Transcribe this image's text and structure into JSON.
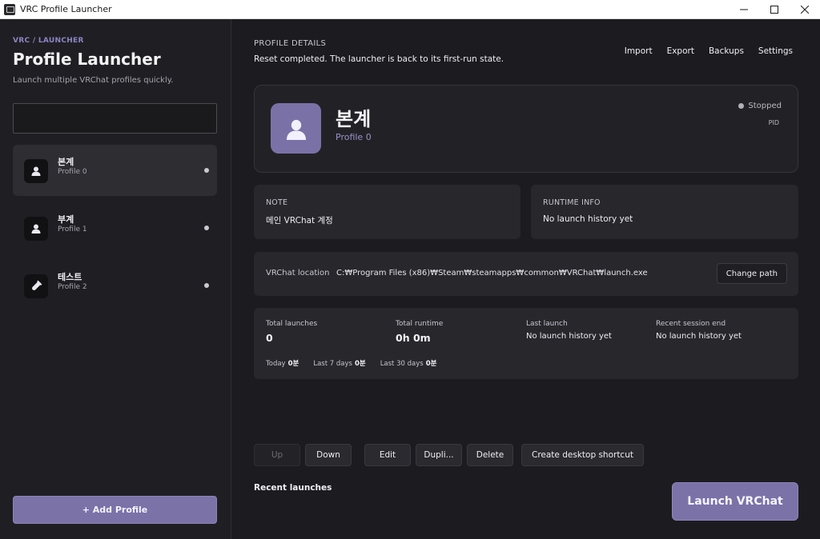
{
  "window": {
    "title": "VRC Profile Launcher",
    "minimize_glyph": "—",
    "maximize_glyph": "☐",
    "close_glyph": "✕"
  },
  "sidebar": {
    "breadcrumb": "VRC / LAUNCHER",
    "title": "Profile Launcher",
    "subtitle": "Launch multiple VRChat profiles quickly.",
    "search": {
      "value": "",
      "placeholder": ""
    },
    "profiles": [
      {
        "name": "본계",
        "sub": "Profile 0",
        "icon": "person-icon",
        "active": true
      },
      {
        "name": "부계",
        "sub": "Profile 1",
        "icon": "person-icon",
        "active": false
      },
      {
        "name": "테스트",
        "sub": "Profile 2",
        "icon": "test-tube-icon",
        "active": false
      }
    ],
    "add_profile_label": "+ Add Profile"
  },
  "main": {
    "section_label": "PROFILE DETAILS",
    "status_message": "Reset completed. The launcher is back to its first-run state.",
    "nav": [
      "Import",
      "Export",
      "Backups",
      "Settings"
    ],
    "hero": {
      "name": "본계",
      "sub": "Profile 0",
      "status": "Stopped",
      "pid_label": "PID"
    },
    "note": {
      "label": "NOTE",
      "value": "메인 VRChat 계정"
    },
    "runtime": {
      "label": "RUNTIME INFO",
      "value": "No launch history yet"
    },
    "location": {
      "label": "VRChat location",
      "path": "C:₩Program Files (x86)₩Steam₩steamapps₩common₩VRChat₩launch.exe",
      "change_label": "Change path"
    },
    "stats": {
      "total_launches_label": "Total launches",
      "total_launches": "0",
      "total_runtime_label": "Total runtime",
      "total_runtime": "0h 0m",
      "last_launch_label": "Last launch",
      "last_launch": "No launch history yet",
      "recent_end_label": "Recent session end",
      "recent_end": "No launch history yet",
      "today_label": "Today",
      "today": "0분",
      "last7_label": "Last 7 days",
      "last7": "0분",
      "last30_label": "Last 30 days",
      "last30": "0분"
    },
    "actions": {
      "up": "Up",
      "down": "Down",
      "edit": "Edit",
      "duplicate": "Dupli...",
      "delete": "Delete",
      "shortcut": "Create desktop shortcut"
    },
    "recent_launches_title": "Recent launches",
    "launch_label": "Launch VRChat"
  },
  "colors": {
    "accent": "#7b72a8",
    "background": "#1c1c20",
    "sidebar": "#1f1f23"
  }
}
